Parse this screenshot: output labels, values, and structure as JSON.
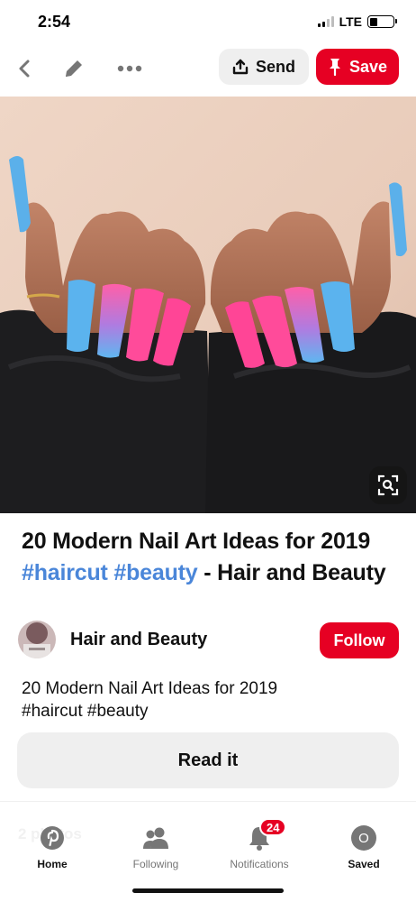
{
  "status_bar": {
    "time": "2:54",
    "network": "LTE"
  },
  "topnav": {
    "back_icon": "chevron-left-icon",
    "edit_icon": "pencil-icon",
    "more_icon": "more-dots-icon",
    "send_label": "Send",
    "send_icon": "share-upload-icon",
    "save_label": "Save",
    "save_icon": "pushpin-icon"
  },
  "pin": {
    "image_subject": "hands with pink and blue coffin nails",
    "lens_icon": "visual-search-icon",
    "title_part1": "20 Modern Nail Art Ideas for 2019 ",
    "title_hashtags": "#haircut #beauty",
    "title_part2": " - Hair and Beauty",
    "creator_name": "Hair and Beauty",
    "follow_label": "Follow",
    "description_line1": "20 Modern Nail Art Ideas for 2019",
    "description_line2": "#haircut #beauty",
    "read_it_label": "Read it"
  },
  "tabbar": {
    "ghost_text": "2 photos",
    "tabs": [
      {
        "label": "Home",
        "icon": "pinterest-logo-icon"
      },
      {
        "label": "Following",
        "icon": "people-icon"
      },
      {
        "label": "Notifications",
        "icon": "bell-icon",
        "badge": "24"
      },
      {
        "label": "Saved",
        "icon": "profile-avatar-icon",
        "avatar_letter": "O"
      }
    ]
  },
  "colors": {
    "brand_red": "#e60023",
    "hashtag_blue": "#4a86d9",
    "button_gray": "#efefef"
  }
}
